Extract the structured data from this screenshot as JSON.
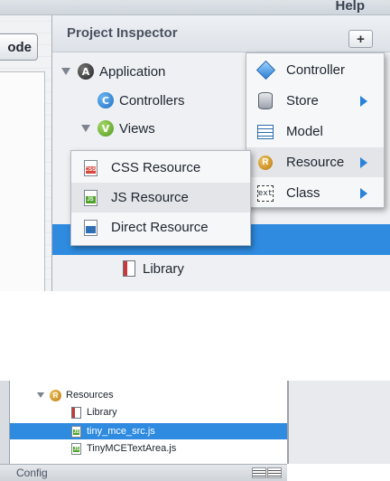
{
  "menubar": {
    "help_label": "Help"
  },
  "left_panel": {
    "mode_button_label": "ode"
  },
  "inspector": {
    "title": "Project Inspector",
    "add_button": "+",
    "tree": {
      "application": "Application",
      "controllers": "Controllers",
      "views": "Views",
      "library": "Library"
    }
  },
  "add_menu": {
    "items": [
      {
        "label": "Controller",
        "icon": "controller-diamond-icon",
        "submenu": false
      },
      {
        "label": "Store",
        "icon": "store-database-icon",
        "submenu": true
      },
      {
        "label": "Model",
        "icon": "model-icon",
        "submenu": false
      },
      {
        "label": "Resource",
        "icon": "resource-icon",
        "submenu": true,
        "highlighted": true
      },
      {
        "label": "Class",
        "icon": "ext-class-icon",
        "submenu": true
      }
    ],
    "class_icon_text": "ext"
  },
  "resource_submenu": {
    "items": [
      {
        "label": "CSS Resource",
        "icon": "css-file-icon",
        "badge": "CSS"
      },
      {
        "label": "JS Resource",
        "icon": "js-file-icon",
        "badge": "JS",
        "highlighted": true
      },
      {
        "label": "Direct Resource",
        "icon": "direct-file-icon",
        "badge": ""
      }
    ]
  },
  "bottom_tree": {
    "resources": "Resources",
    "library": "Library",
    "file1": "tiny_mce_src.js",
    "file2": "TinyMCETextArea.js",
    "config_label": "Config"
  },
  "colors": {
    "selection": "#2e8be0",
    "submenu_arrow": "#2c82da"
  }
}
